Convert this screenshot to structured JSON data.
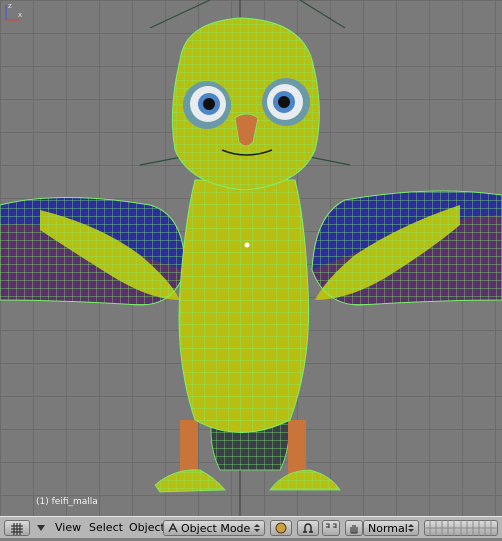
{
  "viewport": {
    "object_label": "(1) feifi_malla",
    "axis_labels": {
      "x": "x",
      "z": "z"
    },
    "colors": {
      "body": "#b8bf12",
      "wireframe": "#7cf06a",
      "wing_blue": "#2d2d9a",
      "wing_purple": "#5a2f6a",
      "beak": "#c8743a",
      "eye_ring": "#6a9aa8"
    }
  },
  "header": {
    "view_type_icon": "grid-icon",
    "menu_toggle_icon": "triangle-down-icon",
    "view_menu": "View",
    "select_menu": "Select",
    "object_menu": "Object",
    "mode_icon": "object-mode-icon",
    "mode_label": "Object Mode",
    "shading_icon": "sphere-icon",
    "pivot_icon": "pivot-icon",
    "manipulator_icon": "magnet-icon",
    "hand_icon": "hand-icon",
    "orientation_label": "Normal",
    "layers_icon": "layer-grid-icon"
  }
}
